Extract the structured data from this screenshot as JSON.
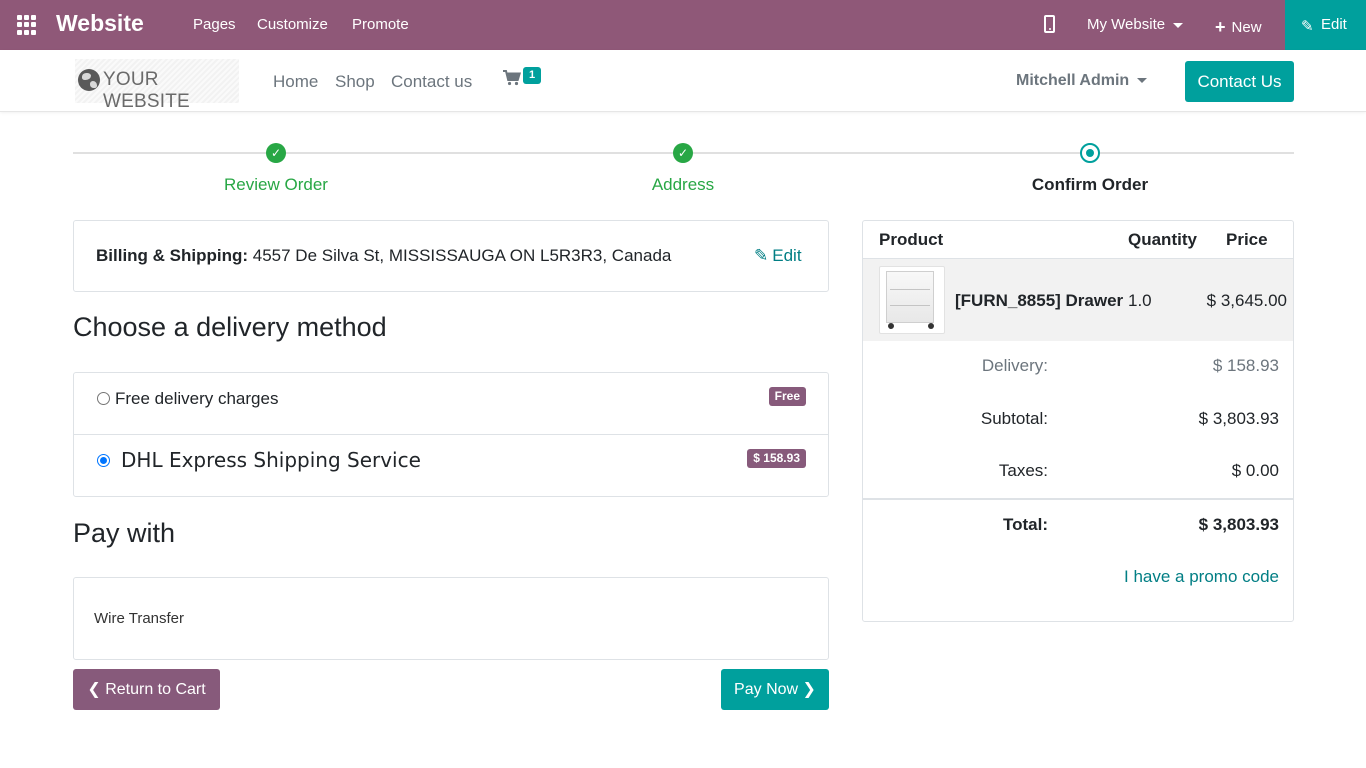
{
  "adminbar": {
    "brand": "Website",
    "menu": [
      "Pages",
      "Customize",
      "Promote"
    ],
    "site_selector": "My Website",
    "new_label": "New",
    "edit_label": "Edit"
  },
  "header": {
    "logo_text": "YOUR WEBSITE",
    "nav": [
      "Home",
      "Shop",
      "Contact us"
    ],
    "cart_count": "1",
    "user": "Mitchell Admin",
    "contact_button": "Contact Us"
  },
  "wizard": {
    "steps": [
      {
        "label": "Review Order",
        "state": "done"
      },
      {
        "label": "Address",
        "state": "done"
      },
      {
        "label": "Confirm Order",
        "state": "current"
      }
    ]
  },
  "billing": {
    "label": "Billing & Shipping:",
    "address": "4557 De Silva St, MISSISSAUGA ON L5R3R3, Canada",
    "edit_label": "Edit"
  },
  "delivery": {
    "title": "Choose a delivery method",
    "options": [
      {
        "label": "Free delivery charges",
        "price": "Free",
        "selected": false
      },
      {
        "label": "DHL Express Shipping Service",
        "price": "$ 158.93",
        "selected": true
      }
    ]
  },
  "payment": {
    "title": "Pay with",
    "method": "Wire Transfer"
  },
  "buttons": {
    "return": "Return to Cart",
    "pay": "Pay Now"
  },
  "summary": {
    "headers": {
      "product": "Product",
      "quantity": "Quantity",
      "price": "Price"
    },
    "line": {
      "name": "[FURN_8855] Drawer",
      "quantity": "1.0",
      "price": "$ 3,645.00"
    },
    "delivery_label": "Delivery:",
    "delivery_value": "$ 158.93",
    "subtotal_label": "Subtotal:",
    "subtotal_value": "$ 3,803.93",
    "taxes_label": "Taxes:",
    "taxes_value": "$ 0.00",
    "total_label": "Total:",
    "total_value": "$ 3,803.93",
    "promo_label": "I have a promo code"
  },
  "colors": {
    "adminbar": "#8f5878",
    "accent": "#00a09d",
    "secondary": "#875a7b",
    "success": "#28a745"
  }
}
